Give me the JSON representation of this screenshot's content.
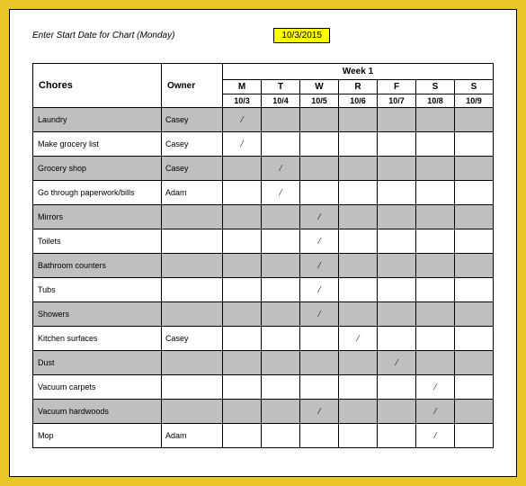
{
  "instruction": "Enter Start Date for Chart (Monday)",
  "start_date": "10/3/2015",
  "week_label": "Week 1",
  "chores_header": "Chores",
  "owner_header": "Owner",
  "days": [
    "M",
    "T",
    "W",
    "R",
    "F",
    "S",
    "S"
  ],
  "dates": [
    "10/3",
    "10/4",
    "10/5",
    "10/6",
    "10/7",
    "10/8",
    "10/9"
  ],
  "mark_symbol": "/",
  "rows": [
    {
      "chore": "Laundry",
      "owner": "Casey",
      "marks": [
        true,
        false,
        false,
        false,
        false,
        false,
        false
      ],
      "shaded": true
    },
    {
      "chore": "Make grocery list",
      "owner": "Casey",
      "marks": [
        true,
        false,
        false,
        false,
        false,
        false,
        false
      ],
      "shaded": false
    },
    {
      "chore": "Grocery shop",
      "owner": "Casey",
      "marks": [
        false,
        true,
        false,
        false,
        false,
        false,
        false
      ],
      "shaded": true
    },
    {
      "chore": "Go through paperwork/bills",
      "owner": "Adam",
      "marks": [
        false,
        true,
        false,
        false,
        false,
        false,
        false
      ],
      "shaded": false
    },
    {
      "chore": "Mirrors",
      "owner": "",
      "marks": [
        false,
        false,
        true,
        false,
        false,
        false,
        false
      ],
      "shaded": true
    },
    {
      "chore": "Toilets",
      "owner": "",
      "marks": [
        false,
        false,
        true,
        false,
        false,
        false,
        false
      ],
      "shaded": false
    },
    {
      "chore": "Bathroom counters",
      "owner": "",
      "marks": [
        false,
        false,
        true,
        false,
        false,
        false,
        false
      ],
      "shaded": true
    },
    {
      "chore": "Tubs",
      "owner": "",
      "marks": [
        false,
        false,
        true,
        false,
        false,
        false,
        false
      ],
      "shaded": false
    },
    {
      "chore": "Showers",
      "owner": "",
      "marks": [
        false,
        false,
        true,
        false,
        false,
        false,
        false
      ],
      "shaded": true
    },
    {
      "chore": "Kitchen surfaces",
      "owner": "Casey",
      "marks": [
        false,
        false,
        false,
        true,
        false,
        false,
        false
      ],
      "shaded": false
    },
    {
      "chore": "Dust",
      "owner": "",
      "marks": [
        false,
        false,
        false,
        false,
        true,
        false,
        false
      ],
      "shaded": true
    },
    {
      "chore": "Vacuum carpets",
      "owner": "",
      "marks": [
        false,
        false,
        false,
        false,
        false,
        true,
        false
      ],
      "shaded": false
    },
    {
      "chore": "Vacuum hardwoods",
      "owner": "",
      "marks": [
        false,
        false,
        true,
        false,
        false,
        true,
        false
      ],
      "shaded": true
    },
    {
      "chore": "Mop",
      "owner": "Adam",
      "marks": [
        false,
        false,
        false,
        false,
        false,
        true,
        false
      ],
      "shaded": false
    }
  ]
}
